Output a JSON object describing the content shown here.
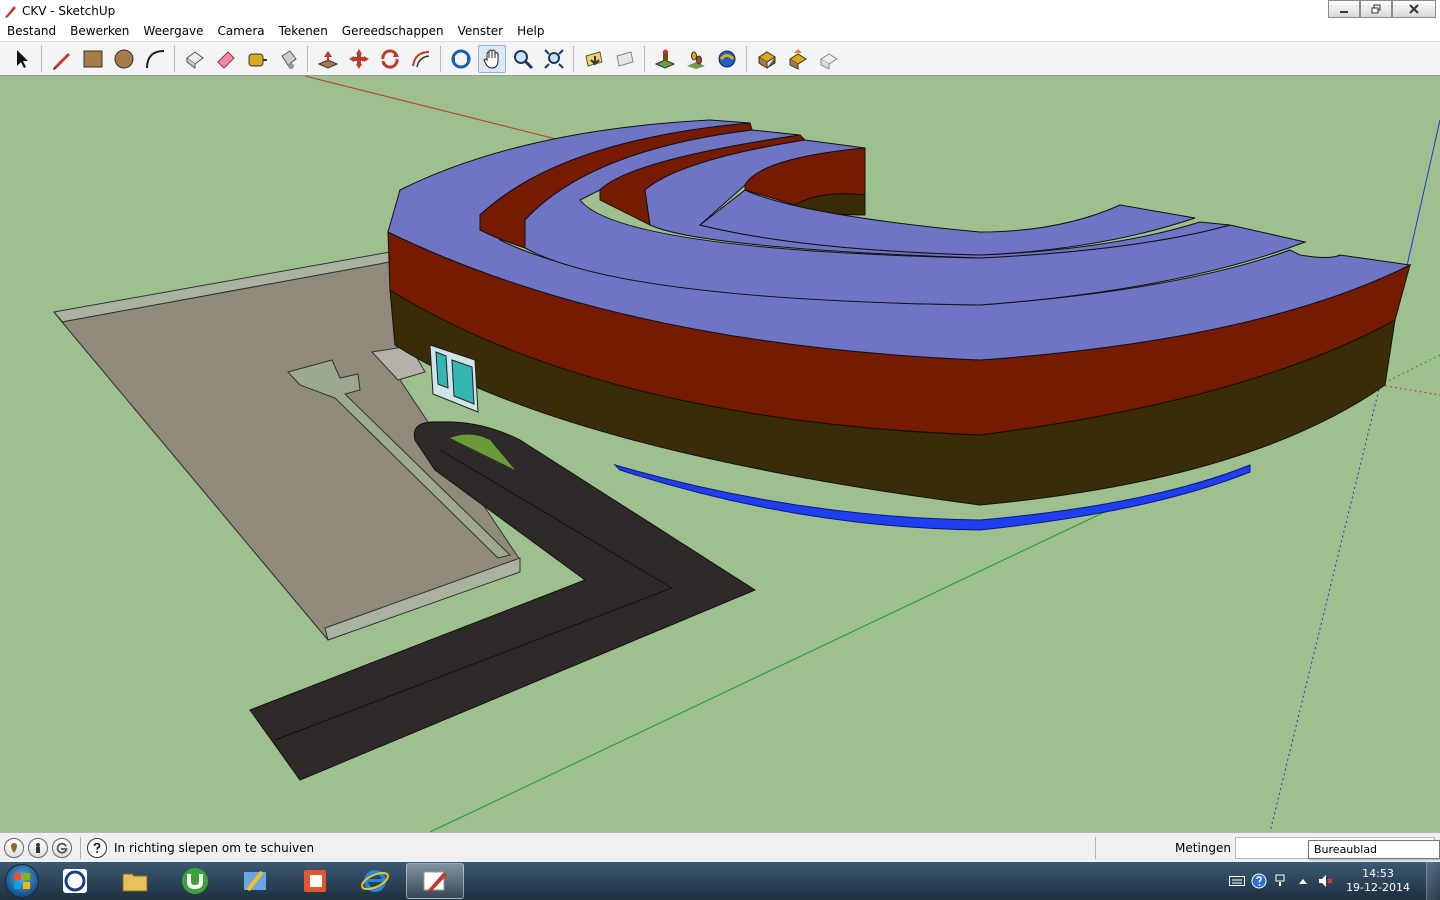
{
  "window": {
    "title": "CKV - SketchUp"
  },
  "menu": [
    "Bestand",
    "Bewerken",
    "Weergave",
    "Camera",
    "Tekenen",
    "Gereedschappen",
    "Venster",
    "Help"
  ],
  "toolbar": {
    "groups": [
      [
        "select-tool"
      ],
      [
        "line-tool",
        "rectangle-tool",
        "circle-tool",
        "arc-tool"
      ],
      [
        "make-component-tool",
        "eraser-tool",
        "tape-measure-tool",
        "paint-bucket-tool"
      ],
      [
        "push-pull-tool",
        "move-tool",
        "rotate-tool",
        "offset-tool"
      ],
      [
        "orbit-tool",
        "pan-tool",
        "zoom-tool",
        "zoom-extents-tool"
      ],
      [
        "previous-view-tool",
        "next-view-tool"
      ],
      [
        "position-camera-tool",
        "walk-tool",
        "look-around-tool"
      ],
      [
        "get-models-tool",
        "share-model-tool",
        "share-component-tool"
      ]
    ],
    "active_tool": "pan-tool"
  },
  "status": {
    "instruction": "In richting slepen om te schuiven",
    "measurements_label": "Metingen",
    "measurements_value": "",
    "icons": [
      "geo-location-icon",
      "credits-icon",
      "google-sign-in-icon"
    ]
  },
  "tooltip": {
    "text": "Bureaublad weergeven"
  },
  "taskbar": {
    "apps": [
      "sketchbook-app",
      "windows-explorer-app",
      "utorrent-app",
      "paint-app",
      "powerpoint-app",
      "internet-explorer-app",
      "sketchup-app"
    ],
    "active_app": "sketchup-app",
    "clock": {
      "time": "14:53",
      "date": "19-12-2014"
    }
  },
  "colors": {
    "viewport_bg": "#9ebf8e",
    "roof": "#6f74c4",
    "wall_red": "#761b00",
    "wall_dark": "#3a2c07",
    "base_blue": "#1f3ef0",
    "road": "#2f2a29",
    "parking": "#8f8a7a"
  }
}
